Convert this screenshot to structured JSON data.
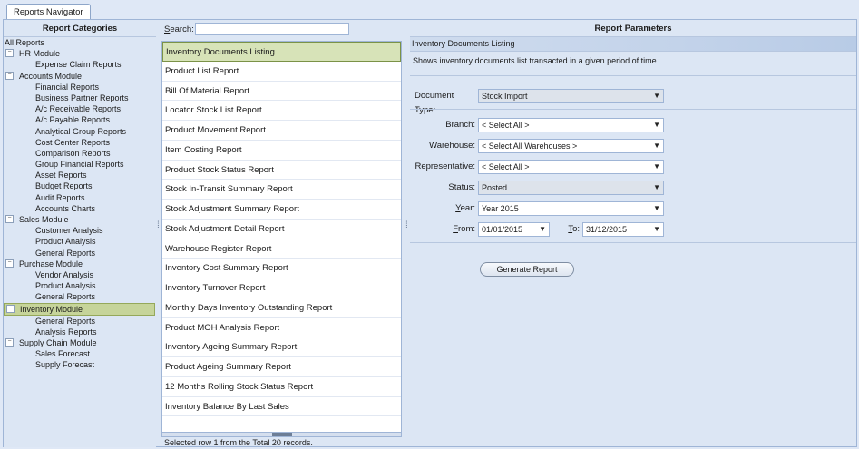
{
  "tab": {
    "label": "Reports Navigator"
  },
  "categories": {
    "header": "Report Categories",
    "items": [
      {
        "label": "All Reports",
        "level": "root"
      },
      {
        "label": "HR Module",
        "level": "mod"
      },
      {
        "label": "Expense Claim Reports",
        "level": "child"
      },
      {
        "label": "Accounts Module",
        "level": "mod"
      },
      {
        "label": "Financial Reports",
        "level": "child"
      },
      {
        "label": "Business Partner Reports",
        "level": "child"
      },
      {
        "label": "A/c Receivable Reports",
        "level": "child"
      },
      {
        "label": "A/c Payable Reports",
        "level": "child"
      },
      {
        "label": "Analytical Group Reports",
        "level": "child"
      },
      {
        "label": "Cost Center Reports",
        "level": "child"
      },
      {
        "label": "Comparison Reports",
        "level": "child"
      },
      {
        "label": "Group Financial Reports",
        "level": "child"
      },
      {
        "label": "Asset Reports",
        "level": "child"
      },
      {
        "label": "Budget Reports",
        "level": "child"
      },
      {
        "label": "Audit Reports",
        "level": "child"
      },
      {
        "label": "Accounts Charts",
        "level": "child"
      },
      {
        "label": "Sales Module",
        "level": "mod"
      },
      {
        "label": "Customer Analysis",
        "level": "child"
      },
      {
        "label": "Product Analysis",
        "level": "child"
      },
      {
        "label": "General Reports",
        "level": "child"
      },
      {
        "label": "Purchase Module",
        "level": "mod"
      },
      {
        "label": "Vendor Analysis",
        "level": "child"
      },
      {
        "label": "Product Analysis",
        "level": "child"
      },
      {
        "label": "General Reports",
        "level": "child"
      },
      {
        "label": "Inventory Module",
        "level": "mod",
        "selected": true
      },
      {
        "label": "General Reports",
        "level": "child"
      },
      {
        "label": "Analysis Reports",
        "level": "child"
      },
      {
        "label": "Supply Chain Module",
        "level": "mod"
      },
      {
        "label": "Sales Forecast",
        "level": "child"
      },
      {
        "label": "Supply Forecast",
        "level": "child"
      }
    ]
  },
  "search": {
    "label": "Search:",
    "value": ""
  },
  "reports": [
    "Inventory Documents Listing",
    "Product List Report",
    "Bill Of Material Report",
    "Locator Stock List Report",
    "Product Movement Report",
    "Item Costing Report",
    "Product Stock Status Report",
    "Stock In-Transit Summary Report",
    "Stock Adjustment Summary Report",
    "Stock Adjustment Detail Report",
    "Warehouse Register Report",
    "Inventory Cost Summary Report",
    "Inventory Turnover Report",
    "Monthly Days Inventory Outstanding Report",
    "Product MOH Analysis Report",
    "Inventory Ageing Summary Report",
    "Product Ageing Summary Report",
    "12 Months Rolling Stock Status Report",
    "Inventory Balance By Last Sales"
  ],
  "status": "Selected row 1 from the Total 20 records.",
  "params": {
    "title": "Report Parameters",
    "report_name": "Inventory Documents Listing",
    "description": "Shows inventory documents list transacted in a given period of time.",
    "document_type": {
      "label": "Document Type:",
      "value": "Stock Import"
    },
    "branch": {
      "label": "Branch:",
      "value": "< Select All >"
    },
    "warehouse": {
      "label": "Warehouse:",
      "value": "< Select All Warehouses >"
    },
    "representative": {
      "label": "Representative:",
      "value": "< Select All >"
    },
    "status": {
      "label": "Status:",
      "value": "Posted"
    },
    "year": {
      "label_first": "Y",
      "label_rest": "ear:",
      "value": "Year 2015"
    },
    "from": {
      "label_first": "F",
      "label_rest": "rom:",
      "value": "01/01/2015"
    },
    "to": {
      "label_first": "T",
      "label_rest": "o:",
      "value": "31/12/2015"
    },
    "generate_button": "Generate Report"
  },
  "colors": {
    "selection": "#c6d49a",
    "panel": "#dce6f4",
    "border": "#9fb5d6"
  }
}
